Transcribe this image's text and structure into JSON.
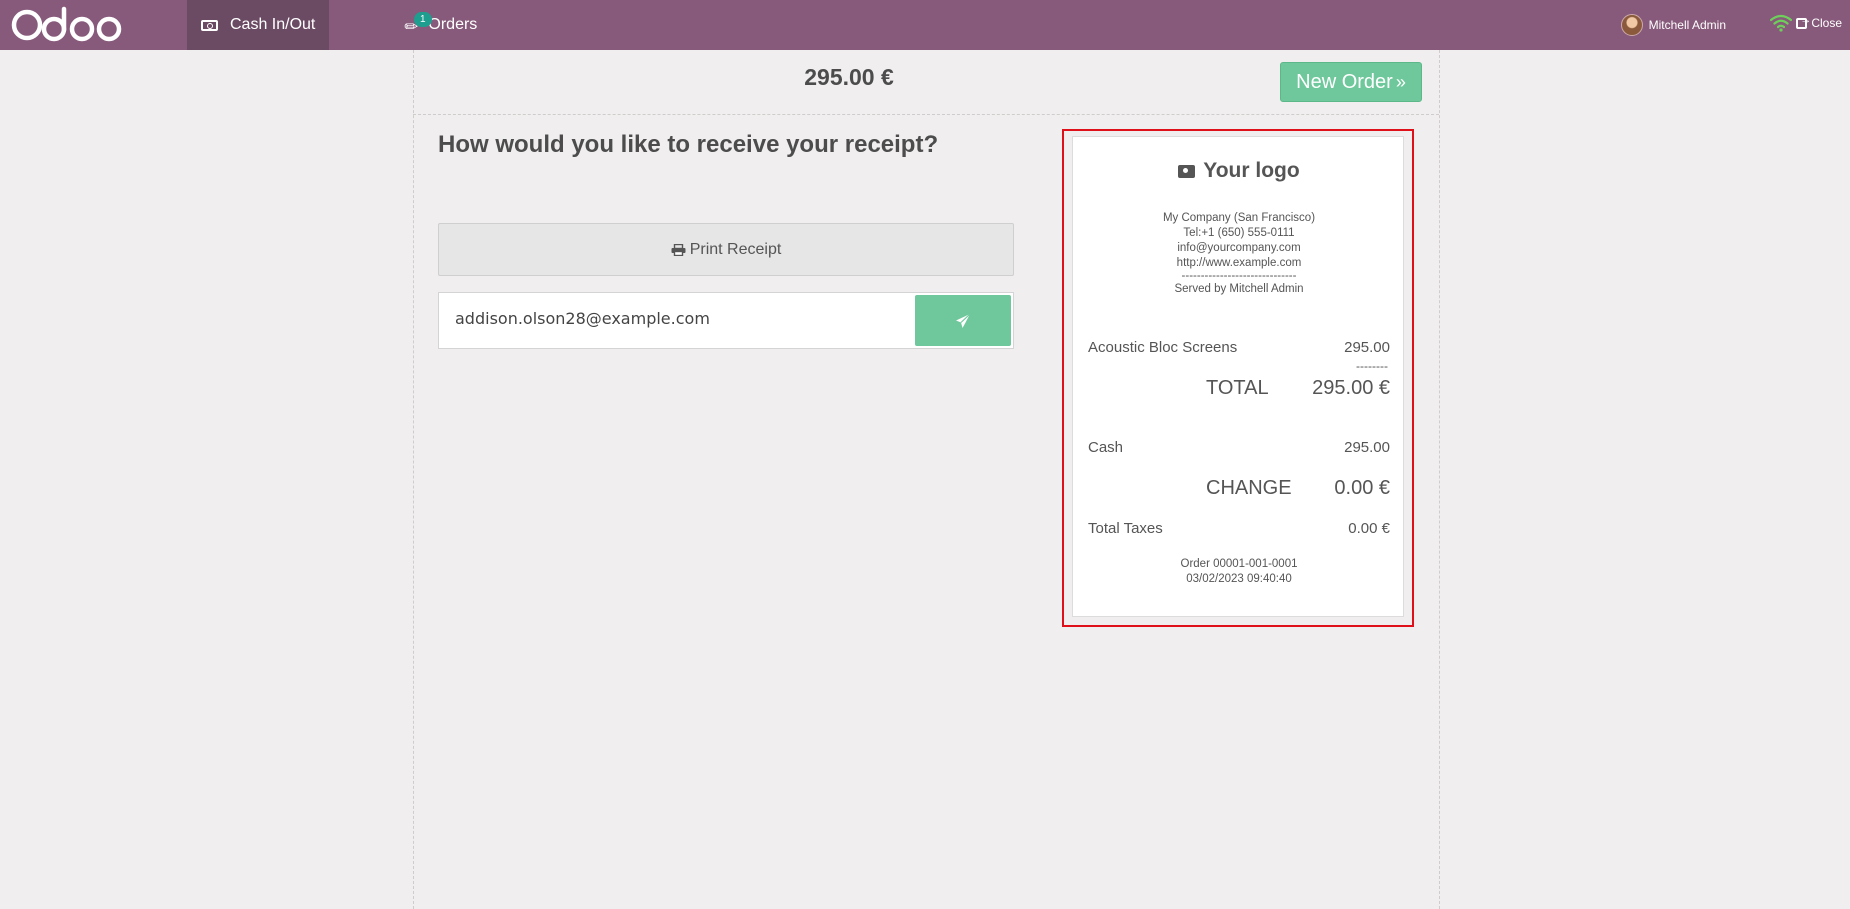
{
  "topbar": {
    "tabs": [
      {
        "label": "Cash In/Out"
      },
      {
        "label": "Orders",
        "badge": "1"
      }
    ],
    "user_name": "Mitchell Admin",
    "close_label": "Close"
  },
  "header": {
    "amount": "295.00 €",
    "new_order_label": "New Order"
  },
  "main": {
    "question": "How would you like to receive your receipt?",
    "print_label": "Print Receipt",
    "email_value": "addison.olson28@example.com"
  },
  "receipt": {
    "logo_text": "Your logo",
    "company_lines": [
      "My Company (San Francisco)",
      "Tel:+1 (650) 555-0111",
      "info@yourcompany.com",
      "http://www.example.com",
      "------------------------------",
      "Served by Mitchell Admin"
    ],
    "line_item": {
      "name": "Acoustic Bloc Screens",
      "amount": "295.00"
    },
    "dash": "--------",
    "total": {
      "label": "TOTAL",
      "amount": "295.00 €"
    },
    "payment": {
      "label": "Cash",
      "amount": "295.00"
    },
    "change": {
      "label": "CHANGE",
      "amount": "0.00 €"
    },
    "taxes": {
      "label": "Total Taxes",
      "amount": "0.00 €"
    },
    "footer_lines": [
      "Order 00001-001-0001",
      "03/02/2023 09:40:40"
    ]
  },
  "colors": {
    "brand": "#875a7b",
    "accent_green": "#6ec89b",
    "highlight_red": "#e0101a"
  }
}
